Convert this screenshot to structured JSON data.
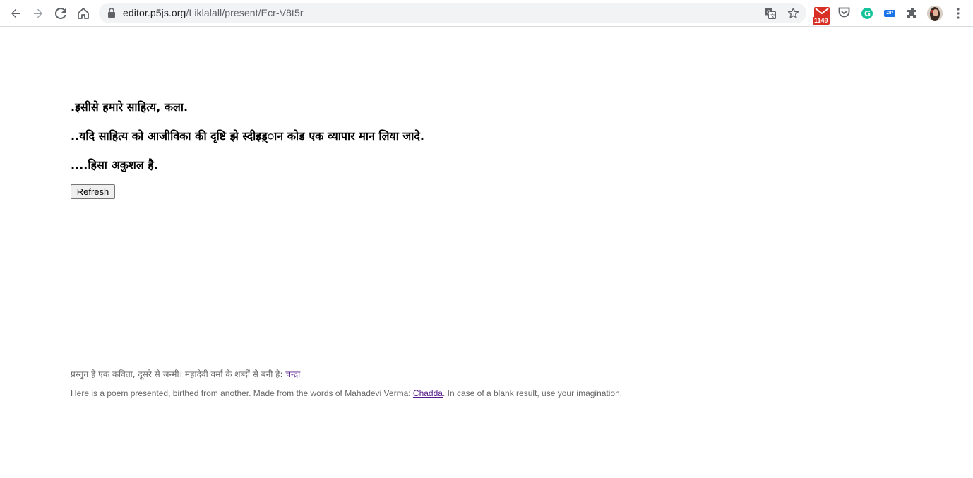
{
  "browser": {
    "url_host": "editor.p5js.org",
    "url_path": "/Liklalall/present/Ecr-V8t5r",
    "gmail_badge": "1149",
    "zip_label": "ZIP"
  },
  "poem": {
    "line1": ".इसीसे हमारे साहित्य, कला.",
    "line2": "..यदि साहित्य को आजीविका की दृष्टि झे स्दीइड़्ान कोड एक व्यापार मान लिया जादे.",
    "line3": "....हिसा अकुशल है."
  },
  "refresh_label": "Refresh",
  "credit_hindi": {
    "text": "प्रस्तुत है एक कविता, दूसरे से जन्मी। महादेवी वर्मा के शब्दों से बनी है: ",
    "link": "चन्द्रा"
  },
  "credit_english": {
    "before": "Here is a poem presented, birthed from another. Made from the words of Mahadevi Verma: ",
    "link": "Chadda",
    "after": ". In case of a blank result, use your imagination."
  },
  "colors": {
    "link_visited": "#551a8b",
    "credit_text": "#666666"
  }
}
